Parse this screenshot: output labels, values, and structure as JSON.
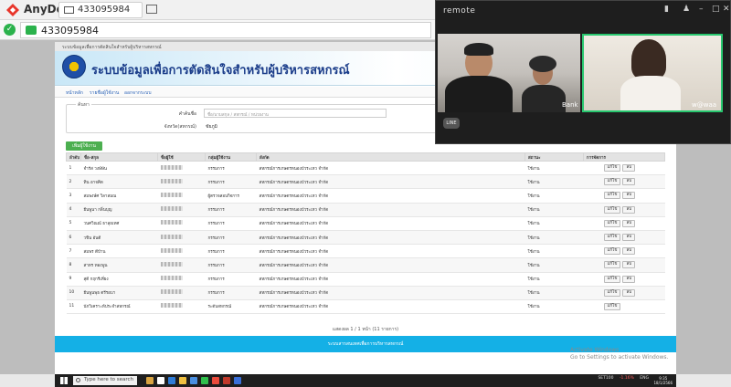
{
  "anydesk": {
    "app_title": "AnyDesk",
    "tab_label": "433095984",
    "address_value": "433095984"
  },
  "browser": {
    "tab_text": "ระบบข้อมูลเพื่อการตัดสินใจสำหรับผู้บริหารสหกรณ์",
    "banner_title": "ระบบข้อมูลเพื่อการตัดสินใจสำหรับผู้บริหารสหกรณ์",
    "nav": [
      "หน้าหลัก",
      "รายชื่อผู้ใช้งาน",
      "ออกจากระบบ"
    ],
    "search": {
      "legend": "ค้นหา",
      "keyword_label": "คำค้นชื่อ",
      "keyword_placeholder": "ชื่อ/นามสกุล / สหกรณ์ / หน่วยงาน",
      "province_label": "จังหวัด(สหกรณ์)",
      "province_value": "ชัยภูมิ"
    },
    "add_button": "เพิ่มผู้ใช้งาน",
    "table": {
      "headers": [
        "ลำดับ",
        "ชื่อ-สกุล",
        "ชื่อผู้ใช้",
        "กลุ่มผู้ใช้งาน",
        "สังกัด",
        "สถานะ",
        "การจัดการ"
      ],
      "edit_label": "แก้ไข",
      "delete_label": "ลบ",
      "rows": [
        {
          "no": "1",
          "name": "จำรัส วงษ์ษัน",
          "group": "กรรมการ",
          "org": "สหกรณ์การเกษตรหนองบัวระเหว จำกัด",
          "status": "ใช้งาน"
        },
        {
          "no": "2",
          "name": "ทิน อาจคิด",
          "group": "กรรมการ",
          "org": "สหกรณ์การเกษตรหนองบัวระเหว จำกัด",
          "status": "ใช้งาน"
        },
        {
          "no": "3",
          "name": "สมพงษ์ศ วิลาสมณ",
          "group": "ผู้ตรวจสอบกิจการ",
          "org": "สหกรณ์การเกษตรหนองบัวระเหว จำกัด",
          "status": "ใช้งาน"
        },
        {
          "no": "4",
          "name": "ยีนพูนา กลิ่นบุญ",
          "group": "กรรมการ",
          "org": "สหกรณ์การเกษตรหนองบัวระเหว จำกัด",
          "status": "ใช้งาน"
        },
        {
          "no": "5",
          "name": "วนศวิณณ์ ธาลุยเทศ",
          "group": "กรรมการ",
          "org": "สหกรณ์การเกษตรหนองบัวระเหว จำกัด",
          "status": "ใช้งาน"
        },
        {
          "no": "6",
          "name": "วชิน อันดี",
          "group": "กรรมการ",
          "org": "สหกรณ์การเกษตรหนองบัวระเหว จำกัด",
          "status": "ใช้งาน"
        },
        {
          "no": "7",
          "name": "สมพร ตีบ้าน",
          "group": "กรรมการ",
          "org": "สหกรณ์การเกษตรหนองบัวระเหว จำกัด",
          "status": "ใช้งาน"
        },
        {
          "no": "8",
          "name": "สาทร ทองพูน",
          "group": "กรรมการ",
          "org": "สหกรณ์การเกษตรหนองบัวระเหว จำกัด",
          "status": "ใช้งาน"
        },
        {
          "no": "9",
          "name": "สุดี กฤกรีเที่ยง",
          "group": "กรรมการ",
          "org": "สหกรณ์การเกษตรหนองบัวระเหว จำกัด",
          "status": "ใช้งาน"
        },
        {
          "no": "10",
          "name": "ยีนพูนพุธ ตรีรอบา",
          "group": "กรรมการ",
          "org": "สหกรณ์การเกษตรหนองบัวระเหว จำกัด",
          "status": "ใช้งาน"
        },
        {
          "no": "11",
          "name": "นักวิเคราะห์ประจำสหกรณ์",
          "group": "ระดับสหกรณ์",
          "org": "สหกรณ์การเกษตรหนองบัวระเหว จำกัด",
          "status": "ใช้งาน"
        }
      ]
    },
    "pager": "แสดงผล 1 / 1 หน้า (11 รายการ)",
    "footer": "ระบบสารสนเทศเพื่อการบริหารสหกรณ์"
  },
  "windows": {
    "activate_line1": "Activate Windows",
    "activate_line2": "Go to Settings to activate Windows.",
    "search_placeholder": "Type here to search",
    "tray": {
      "index": "SET100",
      "change": "-1.16%",
      "lang": "ENG"
    },
    "clock_time": "9:35",
    "clock_date": "18/1/2566"
  },
  "remote": {
    "title": "remote",
    "participant1": "Bank",
    "participant2": "w@waa",
    "line_badge": "LINE"
  }
}
